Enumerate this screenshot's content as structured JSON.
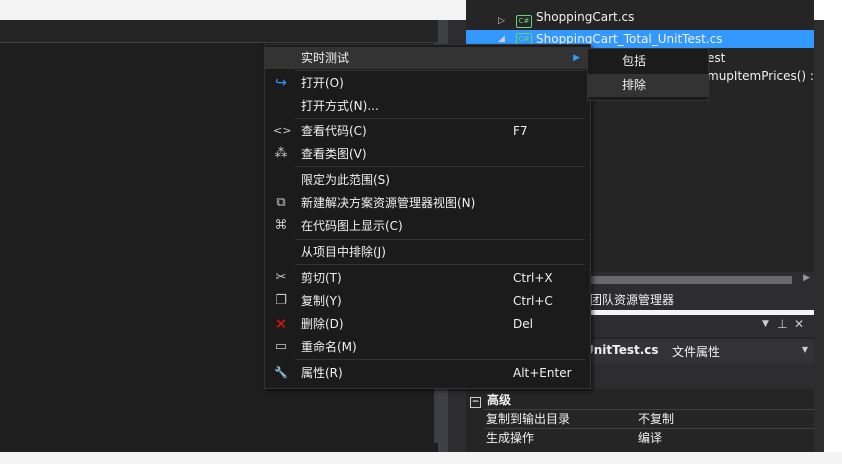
{
  "solution_explorer": {
    "items": [
      {
        "label": "ShoppingCart.cs",
        "expander": "▷",
        "icon": "C#"
      },
      {
        "label": "ShoppingCart_Total_UnitTest.cs",
        "expander": "◢",
        "icon": "C#"
      },
      {
        "label": "est"
      },
      {
        "label": "mupItemPrices() : v"
      }
    ],
    "team_tab": "团队资源管理器"
  },
  "properties": {
    "file_name": "_UnitTest.cs",
    "object_type": "文件属性",
    "category": "高级",
    "rows": [
      {
        "name": "复制到输出目录",
        "value": "不复制"
      },
      {
        "name": "生成操作",
        "value": "编译"
      }
    ]
  },
  "context_menu": {
    "items": [
      {
        "label": "实时测试",
        "shortcut": "",
        "icon": "",
        "submenu": true
      },
      {
        "label": "打开(O)",
        "shortcut": "",
        "icon": "↪"
      },
      {
        "label": "打开方式(N)...",
        "shortcut": "",
        "icon": ""
      },
      {
        "label": "查看代码(C)",
        "shortcut": "F7",
        "icon": "<>"
      },
      {
        "label": "查看类图(V)",
        "shortcut": "",
        "icon": "⁂"
      },
      {
        "label": "限定为此范围(S)",
        "shortcut": "",
        "icon": ""
      },
      {
        "label": "新建解决方案资源管理器视图(N)",
        "shortcut": "",
        "icon": "⧉"
      },
      {
        "label": "在代码图上显示(C)",
        "shortcut": "",
        "icon": "⌘"
      },
      {
        "label": "从项目中排除(J)",
        "shortcut": "",
        "icon": ""
      },
      {
        "label": "剪切(T)",
        "shortcut": "Ctrl+X",
        "icon": "✂"
      },
      {
        "label": "复制(Y)",
        "shortcut": "Ctrl+C",
        "icon": "❐"
      },
      {
        "label": "删除(D)",
        "shortcut": "Del",
        "icon": "✕"
      },
      {
        "label": "重命名(M)",
        "shortcut": "",
        "icon": "▭"
      },
      {
        "label": "属性(R)",
        "shortcut": "Alt+Enter",
        "icon": "🔧"
      }
    ]
  },
  "submenu": {
    "items": [
      {
        "label": "包括"
      },
      {
        "label": "排除"
      }
    ]
  },
  "colors": {
    "selection": "#3399ff",
    "menu_bg": "#1b1b1c",
    "delete_icon": "#e51400",
    "refresh_icon": "#3399ff"
  }
}
